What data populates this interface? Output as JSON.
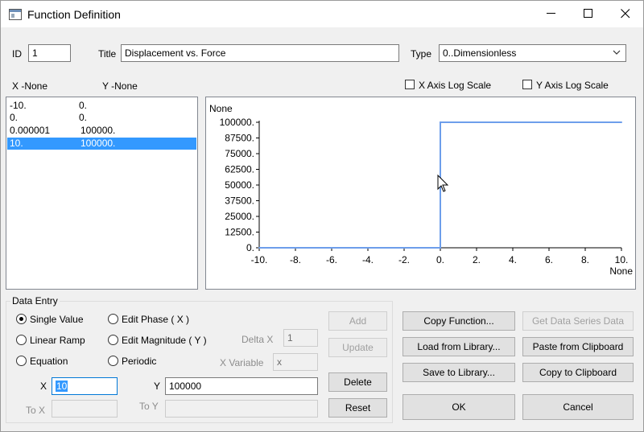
{
  "window": {
    "title": "Function Definition"
  },
  "header": {
    "id_label": "ID",
    "id_value": "1",
    "title_label": "Title",
    "title_value": "Displacement vs. Force",
    "type_label": "Type",
    "type_value": "0..Dimensionless"
  },
  "list": {
    "x_header": "X -None",
    "y_header": "Y -None",
    "rows": [
      {
        "x": "-10.",
        "y": "0."
      },
      {
        "x": "0.",
        "y": "0."
      },
      {
        "x": "0.000001",
        "y": "100000."
      },
      {
        "x": "10.",
        "y": "100000."
      }
    ],
    "selected_index": 3
  },
  "options": {
    "x_log_label": "X Axis Log Scale",
    "y_log_label": "Y Axis Log Scale",
    "x_log_checked": false,
    "y_log_checked": false
  },
  "chart_data": {
    "type": "line",
    "ylabel": "None",
    "xlabel": "None",
    "x": [
      -10,
      0,
      1e-06,
      10
    ],
    "series": [
      {
        "values": [
          0,
          0,
          100000,
          100000
        ],
        "color": "#6d9eeb"
      }
    ],
    "xlim": [
      -10,
      10
    ],
    "ylim": [
      0,
      100000
    ],
    "xticks": [
      -10,
      -8,
      -6,
      -4,
      -2,
      0,
      2,
      4,
      6,
      8,
      10
    ],
    "xtick_labels": [
      "-10.",
      "-8.",
      "-6.",
      "-4.",
      "-2.",
      "0.",
      "2.",
      "4.",
      "6.",
      "8.",
      "10."
    ],
    "yticks": [
      0,
      12500,
      25000,
      37500,
      50000,
      62500,
      75000,
      87500,
      100000
    ],
    "ytick_labels": [
      "0.",
      "12500.",
      "25000.",
      "37500.",
      "50000.",
      "62500.",
      "75000.",
      "87500.",
      "100000."
    ],
    "grid": false
  },
  "data_entry": {
    "group_title": "Data Entry",
    "radios": {
      "single_value": "Single Value",
      "linear_ramp": "Linear Ramp",
      "equation": "Equation",
      "edit_phase": "Edit Phase ( X )",
      "edit_magnitude": "Edit Magnitude ( Y )",
      "periodic": "Periodic"
    },
    "selected_radio": "single_value",
    "delta_x_label": "Delta X",
    "delta_x_value": "1",
    "x_variable_label": "X Variable",
    "x_variable_value": "x",
    "x_label": "X",
    "x_value": "10",
    "y_label": "Y",
    "y_value": "100000",
    "to_x_label": "To X",
    "to_y_label": "To Y",
    "add": "Add",
    "update": "Update",
    "delete": "Delete",
    "reset": "Reset"
  },
  "actions": {
    "copy_function": "Copy Function...",
    "get_data_series": "Get Data Series Data",
    "load_library": "Load from Library...",
    "paste_clipboard": "Paste from Clipboard",
    "save_library": "Save to Library...",
    "copy_clipboard": "Copy to Clipboard",
    "ok": "OK",
    "cancel": "Cancel"
  }
}
